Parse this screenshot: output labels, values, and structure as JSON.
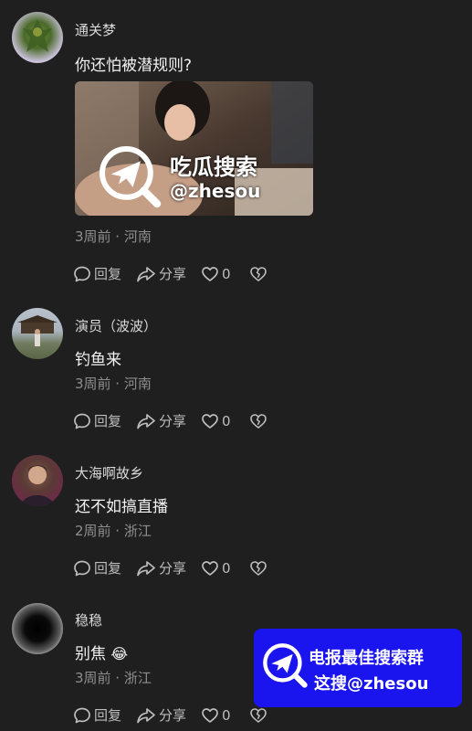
{
  "comments": [
    {
      "username": "通关梦",
      "text": "你还怕被潜规则?",
      "meta": "3周前 · 河南",
      "actions": {
        "reply": "回复",
        "share": "分享",
        "likes": "0"
      }
    },
    {
      "username": "演员（波波）",
      "text": "钓鱼来",
      "meta": "3周前 · 河南",
      "actions": {
        "reply": "回复",
        "share": "分享",
        "likes": "0"
      }
    },
    {
      "username": "大海啊故乡",
      "text": "还不如搞直播",
      "meta": "2周前 · 浙江",
      "actions": {
        "reply": "回复",
        "share": "分享",
        "likes": "0"
      }
    },
    {
      "username": "稳稳",
      "text": "别焦",
      "emoji": "😂",
      "meta": "3周前 · 浙江",
      "actions": {
        "reply": "回复",
        "share": "分享",
        "likes": "0"
      }
    }
  ],
  "image_watermark": {
    "line1": "吃瓜搜索",
    "line2": "@zhesou"
  },
  "banner": {
    "line1": "电报最佳搜索群",
    "line2": "这搜@zhesou",
    "color": "#1a14ef"
  },
  "icons": [
    "comment-icon",
    "share-icon",
    "heart-icon",
    "broken-heart-icon"
  ]
}
